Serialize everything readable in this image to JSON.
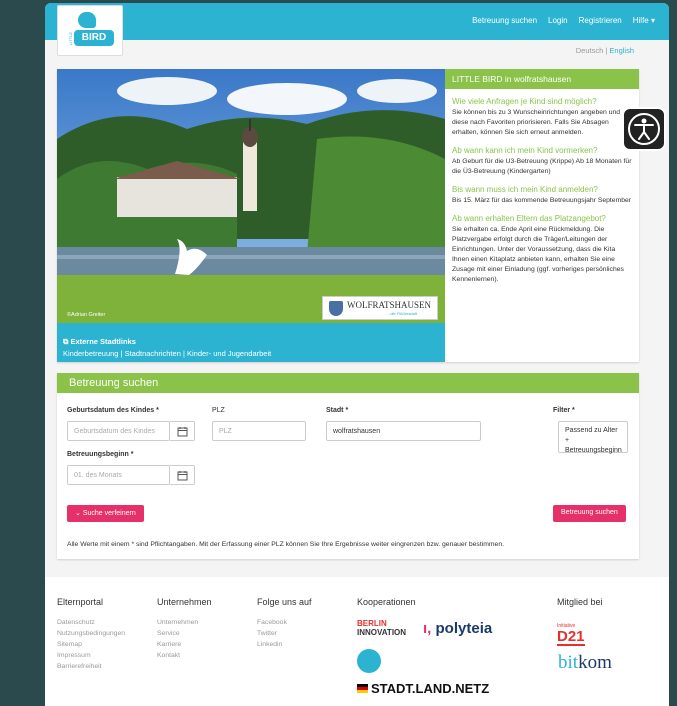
{
  "header": {
    "logo_text": "BIRD",
    "logo_small": "LITTLE",
    "nav": [
      "Betreuung suchen",
      "Login",
      "Registrieren",
      "Hilfe ▾"
    ],
    "lang_de": "Deutsch",
    "lang_sep": "|",
    "lang_en": "English"
  },
  "hero": {
    "credit": "©Adrian Greiter",
    "city_logo": "WOLFRATSHAUSEN",
    "city_logo_sub": "...die Flößerstadt",
    "external_title": "Externe Stadtlinks",
    "external_links": "Kinderbetreuung  |  Stadtnachrichten  |  Kinder- und Jugendarbeit"
  },
  "info": {
    "title": "LITTLE BIRD in wolfratshausen",
    "items": [
      {
        "q": "Wie viele Anfragen je Kind sind möglich?",
        "a": "Sie können bis zu 3 Wunscheinrichtungen angeben und diese nach Favoriten priorisieren. Falls Sie Absagen erhalten, können Sie sich erneut anmelden."
      },
      {
        "q": "Ab wann kann ich mein Kind vormerken?",
        "a": "Ab Geburt für die U3-Betreuung (Krippe) Ab 18 Monaten für die Ü3-Betreuung (Kindergarten)"
      },
      {
        "q": "Bis wann muss ich mein Kind anmelden?",
        "a": "Bis 15. März für das kommende Betreuungsjahr September"
      },
      {
        "q": "Ab wann erhalten Eltern das Platzangebot?",
        "a": "Sie erhalten ca. Ende April eine Rückmeldung. Die Platzvergabe erfolgt durch die Träger/Leitungen der Einrichtungen. Unter der Voraussetzung, dass die Kita Ihnen einen Kitaplatz anbieten kann, erhalten Sie eine Zusage mit einer Einladung (ggf. vorheriges persönliches Kennenlernen)."
      }
    ]
  },
  "search": {
    "title": "Betreuung suchen",
    "birth_label": "Geburtsdatum des Kindes *",
    "birth_placeholder": "Geburtsdatum des Kindes",
    "plz_label": "PLZ",
    "plz_placeholder": "PLZ",
    "city_label": "Stadt *",
    "city_value": "wolfratshausen",
    "filter_label": "Filter *",
    "filter_value": "Passend zu Alter + Betreuungsbeginn",
    "start_label": "Betreuungsbeginn *",
    "start_placeholder": "01. des Monats",
    "refine_button": "Suche verfeinern",
    "search_button": "Betreuung suchen",
    "note": "Alle Werte mit einem * sind Pflichtangaben. Mit der Erfassung einer PLZ können Sie Ihre Ergebnisse weiter eingrenzen bzw. genauer bestimmen."
  },
  "footer": {
    "cols": [
      {
        "title": "Elternportal",
        "links": [
          "Datenschutz",
          "Nutzungsbedingungen",
          "Sitemap",
          "Impressum",
          "Barrierefreiheit"
        ]
      },
      {
        "title": "Unternehmen",
        "links": [
          "Unternehmen",
          "Service",
          "Karriere",
          "Kontakt"
        ]
      },
      {
        "title": "Folge uns auf",
        "links": [
          "Facebook",
          "Twitter",
          "Linkedin"
        ]
      }
    ],
    "koop_title": "Kooperationen",
    "berlin_1": "BERLIN",
    "berlin_2": "INNOVATION",
    "polyteia": "polyteia",
    "polyteia_mark": "ı,",
    "stadt": "STADT.LAND.NETZ",
    "member_title": "Mitglied bei",
    "d21_init": "Initiative",
    "d21": "D21",
    "bitkom_b": "bit",
    "bitkom_k": "kom"
  },
  "colors": {
    "accent": "#2bb3d1",
    "green": "#8bc34a",
    "pink": "#e6306a"
  }
}
